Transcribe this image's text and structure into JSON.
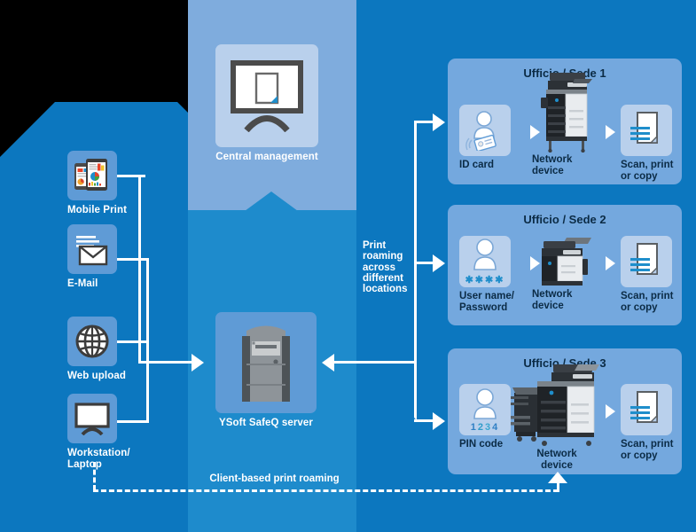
{
  "colors": {
    "band_left": "#0c77bf",
    "band_center": "#1e8bcc",
    "band_center_top": "#7facdd",
    "band_right": "#0c77bf",
    "tile": "#5f9bd6",
    "tile_light": "#b9d0ec",
    "office_panel": "#74a8de",
    "connector": "#ffffff",
    "caption_dark": "#0b2b45"
  },
  "left_column": {
    "items": [
      {
        "label": "Mobile Print",
        "icon": "mobile-print-icon"
      },
      {
        "label": "E-Mail",
        "icon": "email-icon"
      },
      {
        "label": "Web upload",
        "icon": "globe-icon"
      },
      {
        "label": "Workstation/\nLaptop",
        "icon": "workstation-icon"
      }
    ]
  },
  "center_column": {
    "management": {
      "label": "Central management",
      "icon": "monitor-document-icon"
    },
    "server": {
      "label": "YSoft SafeQ server",
      "icon": "server-tower-icon"
    }
  },
  "labels": {
    "print_roaming": "Print roaming across different locations",
    "print_roaming_lines": [
      "Print",
      "roaming",
      "across",
      "different",
      "locations"
    ],
    "client_based_print_roaming": "Client-based print roaming"
  },
  "offices": [
    {
      "title": "Ufficio / Sede 1",
      "auth": {
        "label": "ID card",
        "icon": "id-card-user-icon"
      },
      "device": {
        "label": "Network device",
        "lines": [
          "Network",
          "device"
        ],
        "icon": "mfp-large-icon"
      },
      "output": {
        "label": "Scan, print or copy",
        "lines": [
          "Scan, print",
          "or copy"
        ],
        "icon": "documents-icon"
      }
    },
    {
      "title": "Ufficio / Sede 2",
      "auth": {
        "label": "User name/ Password",
        "lines": [
          "User name/",
          "Password"
        ],
        "icon": "user-password-icon",
        "mask": "✱✱✱✱"
      },
      "device": {
        "label": "Network device",
        "lines": [
          "Network",
          "device"
        ],
        "icon": "mfp-small-icon"
      },
      "output": {
        "label": "Scan, print or copy",
        "lines": [
          "Scan, print",
          "or copy"
        ],
        "icon": "documents-icon"
      }
    },
    {
      "title": "Ufficio / Sede 3",
      "auth": {
        "label": "PIN code",
        "icon": "pin-code-user-icon",
        "pin": "1234",
        "pin_digits": [
          "1",
          "2",
          "3",
          "4"
        ]
      },
      "device": {
        "label": "Network device",
        "lines": [
          "Network",
          "device"
        ],
        "icon": "mfp-finisher-icon"
      },
      "output": {
        "label": "Scan, print or copy",
        "lines": [
          "Scan, print",
          "or copy"
        ],
        "icon": "documents-icon"
      }
    }
  ]
}
